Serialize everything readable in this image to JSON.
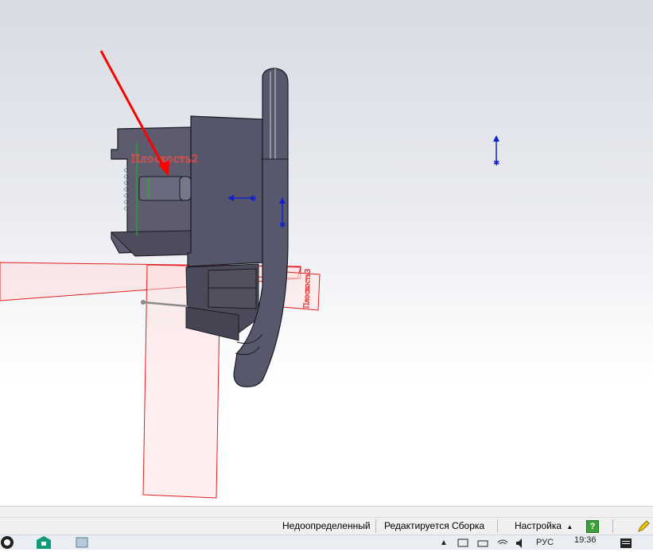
{
  "viewport": {
    "plane2_label": "Плоскость2",
    "plane3_label": "Плоскость3",
    "colors": {
      "part": "#5c5c6e",
      "part_edge": "#1a1a24",
      "plane": "#e02020",
      "arrow": "#ff0000",
      "axis": "#1020d0",
      "sketch": "#22b022"
    }
  },
  "status_bar": {
    "state": "Недоопределенный",
    "mode": "Редактируется Сборка",
    "units": "Настройка",
    "units_caret": "▲",
    "help": "?"
  },
  "taskbar": {
    "lang": "РУС",
    "time": "19:36",
    "tray_caret": "▲"
  }
}
